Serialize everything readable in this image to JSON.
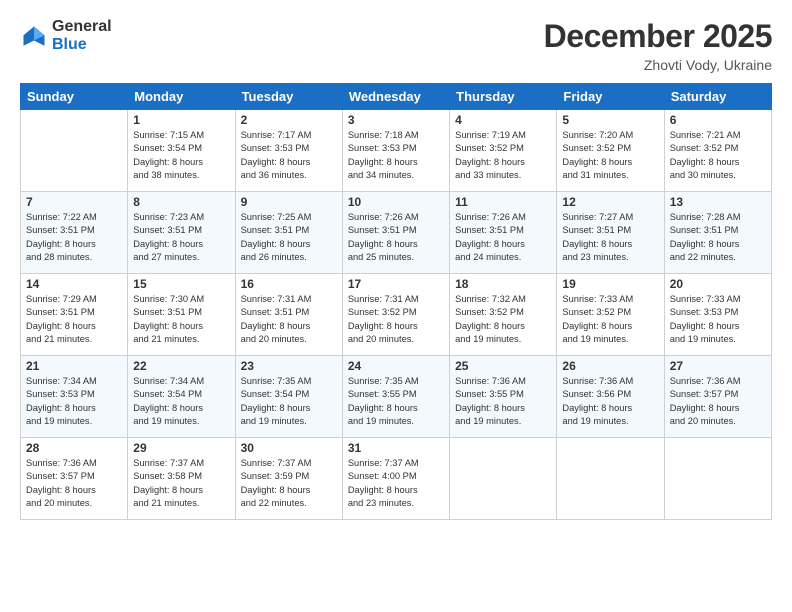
{
  "header": {
    "logo_general": "General",
    "logo_blue": "Blue",
    "month_title": "December 2025",
    "subtitle": "Zhovti Vody, Ukraine"
  },
  "days_of_week": [
    "Sunday",
    "Monday",
    "Tuesday",
    "Wednesday",
    "Thursday",
    "Friday",
    "Saturday"
  ],
  "weeks": [
    [
      {
        "day": "",
        "sunrise": "",
        "sunset": "",
        "daylight": ""
      },
      {
        "day": "1",
        "sunrise": "Sunrise: 7:15 AM",
        "sunset": "Sunset: 3:54 PM",
        "daylight": "Daylight: 8 hours and 38 minutes."
      },
      {
        "day": "2",
        "sunrise": "Sunrise: 7:17 AM",
        "sunset": "Sunset: 3:53 PM",
        "daylight": "Daylight: 8 hours and 36 minutes."
      },
      {
        "day": "3",
        "sunrise": "Sunrise: 7:18 AM",
        "sunset": "Sunset: 3:53 PM",
        "daylight": "Daylight: 8 hours and 34 minutes."
      },
      {
        "day": "4",
        "sunrise": "Sunrise: 7:19 AM",
        "sunset": "Sunset: 3:52 PM",
        "daylight": "Daylight: 8 hours and 33 minutes."
      },
      {
        "day": "5",
        "sunrise": "Sunrise: 7:20 AM",
        "sunset": "Sunset: 3:52 PM",
        "daylight": "Daylight: 8 hours and 31 minutes."
      },
      {
        "day": "6",
        "sunrise": "Sunrise: 7:21 AM",
        "sunset": "Sunset: 3:52 PM",
        "daylight": "Daylight: 8 hours and 30 minutes."
      }
    ],
    [
      {
        "day": "7",
        "sunrise": "Sunrise: 7:22 AM",
        "sunset": "Sunset: 3:51 PM",
        "daylight": "Daylight: 8 hours and 28 minutes."
      },
      {
        "day": "8",
        "sunrise": "Sunrise: 7:23 AM",
        "sunset": "Sunset: 3:51 PM",
        "daylight": "Daylight: 8 hours and 27 minutes."
      },
      {
        "day": "9",
        "sunrise": "Sunrise: 7:25 AM",
        "sunset": "Sunset: 3:51 PM",
        "daylight": "Daylight: 8 hours and 26 minutes."
      },
      {
        "day": "10",
        "sunrise": "Sunrise: 7:26 AM",
        "sunset": "Sunset: 3:51 PM",
        "daylight": "Daylight: 8 hours and 25 minutes."
      },
      {
        "day": "11",
        "sunrise": "Sunrise: 7:26 AM",
        "sunset": "Sunset: 3:51 PM",
        "daylight": "Daylight: 8 hours and 24 minutes."
      },
      {
        "day": "12",
        "sunrise": "Sunrise: 7:27 AM",
        "sunset": "Sunset: 3:51 PM",
        "daylight": "Daylight: 8 hours and 23 minutes."
      },
      {
        "day": "13",
        "sunrise": "Sunrise: 7:28 AM",
        "sunset": "Sunset: 3:51 PM",
        "daylight": "Daylight: 8 hours and 22 minutes."
      }
    ],
    [
      {
        "day": "14",
        "sunrise": "Sunrise: 7:29 AM",
        "sunset": "Sunset: 3:51 PM",
        "daylight": "Daylight: 8 hours and 21 minutes."
      },
      {
        "day": "15",
        "sunrise": "Sunrise: 7:30 AM",
        "sunset": "Sunset: 3:51 PM",
        "daylight": "Daylight: 8 hours and 21 minutes."
      },
      {
        "day": "16",
        "sunrise": "Sunrise: 7:31 AM",
        "sunset": "Sunset: 3:51 PM",
        "daylight": "Daylight: 8 hours and 20 minutes."
      },
      {
        "day": "17",
        "sunrise": "Sunrise: 7:31 AM",
        "sunset": "Sunset: 3:52 PM",
        "daylight": "Daylight: 8 hours and 20 minutes."
      },
      {
        "day": "18",
        "sunrise": "Sunrise: 7:32 AM",
        "sunset": "Sunset: 3:52 PM",
        "daylight": "Daylight: 8 hours and 19 minutes."
      },
      {
        "day": "19",
        "sunrise": "Sunrise: 7:33 AM",
        "sunset": "Sunset: 3:52 PM",
        "daylight": "Daylight: 8 hours and 19 minutes."
      },
      {
        "day": "20",
        "sunrise": "Sunrise: 7:33 AM",
        "sunset": "Sunset: 3:53 PM",
        "daylight": "Daylight: 8 hours and 19 minutes."
      }
    ],
    [
      {
        "day": "21",
        "sunrise": "Sunrise: 7:34 AM",
        "sunset": "Sunset: 3:53 PM",
        "daylight": "Daylight: 8 hours and 19 minutes."
      },
      {
        "day": "22",
        "sunrise": "Sunrise: 7:34 AM",
        "sunset": "Sunset: 3:54 PM",
        "daylight": "Daylight: 8 hours and 19 minutes."
      },
      {
        "day": "23",
        "sunrise": "Sunrise: 7:35 AM",
        "sunset": "Sunset: 3:54 PM",
        "daylight": "Daylight: 8 hours and 19 minutes."
      },
      {
        "day": "24",
        "sunrise": "Sunrise: 7:35 AM",
        "sunset": "Sunset: 3:55 PM",
        "daylight": "Daylight: 8 hours and 19 minutes."
      },
      {
        "day": "25",
        "sunrise": "Sunrise: 7:36 AM",
        "sunset": "Sunset: 3:55 PM",
        "daylight": "Daylight: 8 hours and 19 minutes."
      },
      {
        "day": "26",
        "sunrise": "Sunrise: 7:36 AM",
        "sunset": "Sunset: 3:56 PM",
        "daylight": "Daylight: 8 hours and 19 minutes."
      },
      {
        "day": "27",
        "sunrise": "Sunrise: 7:36 AM",
        "sunset": "Sunset: 3:57 PM",
        "daylight": "Daylight: 8 hours and 20 minutes."
      }
    ],
    [
      {
        "day": "28",
        "sunrise": "Sunrise: 7:36 AM",
        "sunset": "Sunset: 3:57 PM",
        "daylight": "Daylight: 8 hours and 20 minutes."
      },
      {
        "day": "29",
        "sunrise": "Sunrise: 7:37 AM",
        "sunset": "Sunset: 3:58 PM",
        "daylight": "Daylight: 8 hours and 21 minutes."
      },
      {
        "day": "30",
        "sunrise": "Sunrise: 7:37 AM",
        "sunset": "Sunset: 3:59 PM",
        "daylight": "Daylight: 8 hours and 22 minutes."
      },
      {
        "day": "31",
        "sunrise": "Sunrise: 7:37 AM",
        "sunset": "Sunset: 4:00 PM",
        "daylight": "Daylight: 8 hours and 23 minutes."
      },
      {
        "day": "",
        "sunrise": "",
        "sunset": "",
        "daylight": ""
      },
      {
        "day": "",
        "sunrise": "",
        "sunset": "",
        "daylight": ""
      },
      {
        "day": "",
        "sunrise": "",
        "sunset": "",
        "daylight": ""
      }
    ]
  ]
}
